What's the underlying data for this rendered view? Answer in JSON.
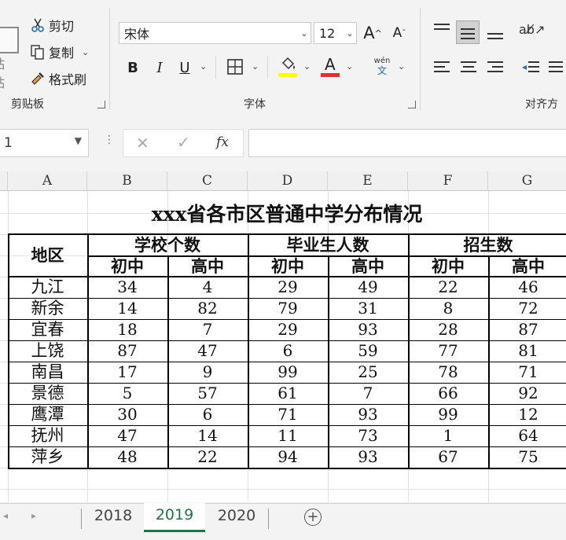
{
  "ribbon": {
    "clipboard": {
      "paste_label": "粘贴",
      "cut_label": "剪切",
      "copy_label": "复制",
      "format_painter_label": "格式刷",
      "group_label": "剪贴板"
    },
    "font": {
      "font_name": "宋体",
      "font_size": "12",
      "bold_label": "B",
      "italic_label": "I",
      "underline_label": "U",
      "phonetic_label": "wén",
      "phonetic_sub": "文",
      "group_label": "字体",
      "fill_color": "#ffff00",
      "font_color": "#e03030"
    },
    "alignment": {
      "group_label": "对齐方"
    }
  },
  "formula_bar": {
    "name_box": "1",
    "fx_label": "fx",
    "formula": ""
  },
  "columns": [
    "A",
    "B",
    "C",
    "D",
    "E",
    "F",
    "G"
  ],
  "table": {
    "title": "xxx省各市区普通中学分布情况",
    "region_header": "地区",
    "groups": [
      "学校个数",
      "毕业生人数",
      "招生数"
    ],
    "sub_headers": [
      "初中",
      "高中",
      "初中",
      "高中",
      "初中",
      "高中"
    ],
    "rows": [
      {
        "region": "九江",
        "values": [
          "34",
          "4",
          "29",
          "49",
          "22",
          "46"
        ]
      },
      {
        "region": "新余",
        "values": [
          "14",
          "82",
          "79",
          "31",
          "8",
          "72"
        ]
      },
      {
        "region": "宜春",
        "values": [
          "18",
          "7",
          "29",
          "93",
          "28",
          "87"
        ]
      },
      {
        "region": "上饶",
        "values": [
          "87",
          "47",
          "6",
          "59",
          "77",
          "81"
        ]
      },
      {
        "region": "南昌",
        "values": [
          "17",
          "9",
          "99",
          "25",
          "78",
          "71"
        ]
      },
      {
        "region": "景德",
        "values": [
          "5",
          "57",
          "61",
          "7",
          "66",
          "92"
        ]
      },
      {
        "region": "鹰潭",
        "values": [
          "30",
          "6",
          "71",
          "93",
          "99",
          "12"
        ]
      },
      {
        "region": "抚州",
        "values": [
          "47",
          "14",
          "11",
          "73",
          "1",
          "64"
        ]
      },
      {
        "region": "萍乡",
        "values": [
          "48",
          "22",
          "94",
          "93",
          "67",
          "75"
        ]
      }
    ]
  },
  "sheet_tabs": [
    "2018",
    "2019",
    "2020"
  ],
  "active_tab": "2019",
  "colors": {
    "active_tab_green": "#217346"
  }
}
